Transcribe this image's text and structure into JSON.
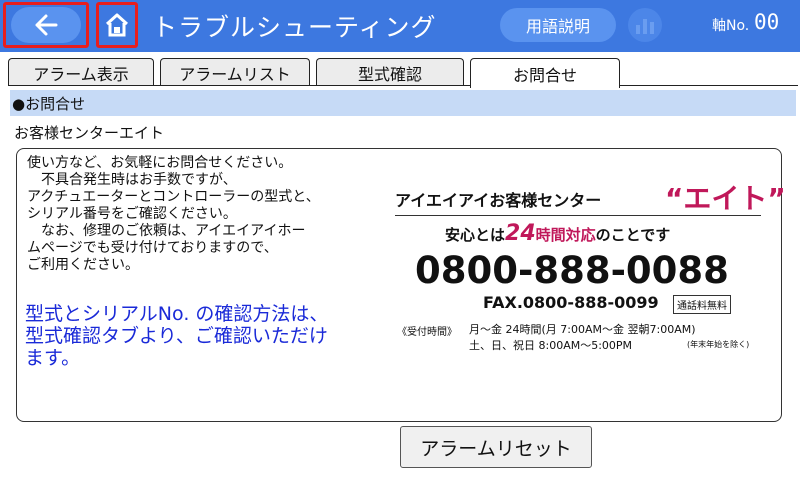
{
  "header": {
    "title": "トラブルシューティング",
    "glossary_label": "用語説明",
    "axis_label": "軸No.",
    "axis_value": "00",
    "colors": {
      "bar": "#3d78e0",
      "pill": "#5a93ef",
      "highlight_border": "#e81e1e"
    },
    "icons": {
      "back": "arrow-left-icon",
      "home": "home-icon",
      "chart": "bar-chart-icon"
    }
  },
  "tabs": [
    {
      "label": "アラーム表示",
      "active": false
    },
    {
      "label": "アラームリスト",
      "active": false
    },
    {
      "label": "型式確認",
      "active": false
    },
    {
      "label": "お問合せ",
      "active": true
    }
  ],
  "section": {
    "heading": "●お問合せ",
    "center_name": "お客様センターエイト"
  },
  "panel": {
    "body_lines": [
      "使い方など、お気軽にお問合せください。",
      "　不具合発生時はお手数ですが、",
      "アクチュエーターとコントローラーの型式と、",
      "シリアル番号をご確認ください。",
      "　なお、修理のご依頼は、アイエイアイホー",
      "ムページでも受け付けておりますので、",
      "ご利用ください。"
    ],
    "blue_lines": [
      "型式とシリアルNo. の確認方法は、",
      "型式確認タブより、ご確認いただけ",
      "ます。"
    ],
    "ad": {
      "title": "アイエイアイお客様センター",
      "name": "“エイト”",
      "tagline_prefix": "安心とは",
      "tagline_num": "24",
      "tagline_red": "時間対応",
      "tagline_suffix": "のことです",
      "phone": "0800-888-0088",
      "fax": "FAX.0800-888-0099",
      "free_call": "通話料無料",
      "hours_label": "《受付時間》",
      "hours_weekday": "月～金 24時間(月 7:00AM～金 翌朝7:00AM)",
      "hours_weekend": "土、日、祝日 8:00AM～5:00PM",
      "hours_note": "(年末年始を除く)",
      "colors": {
        "accent": "#c0185a"
      }
    }
  },
  "footer": {
    "reset_label": "アラームリセット"
  }
}
